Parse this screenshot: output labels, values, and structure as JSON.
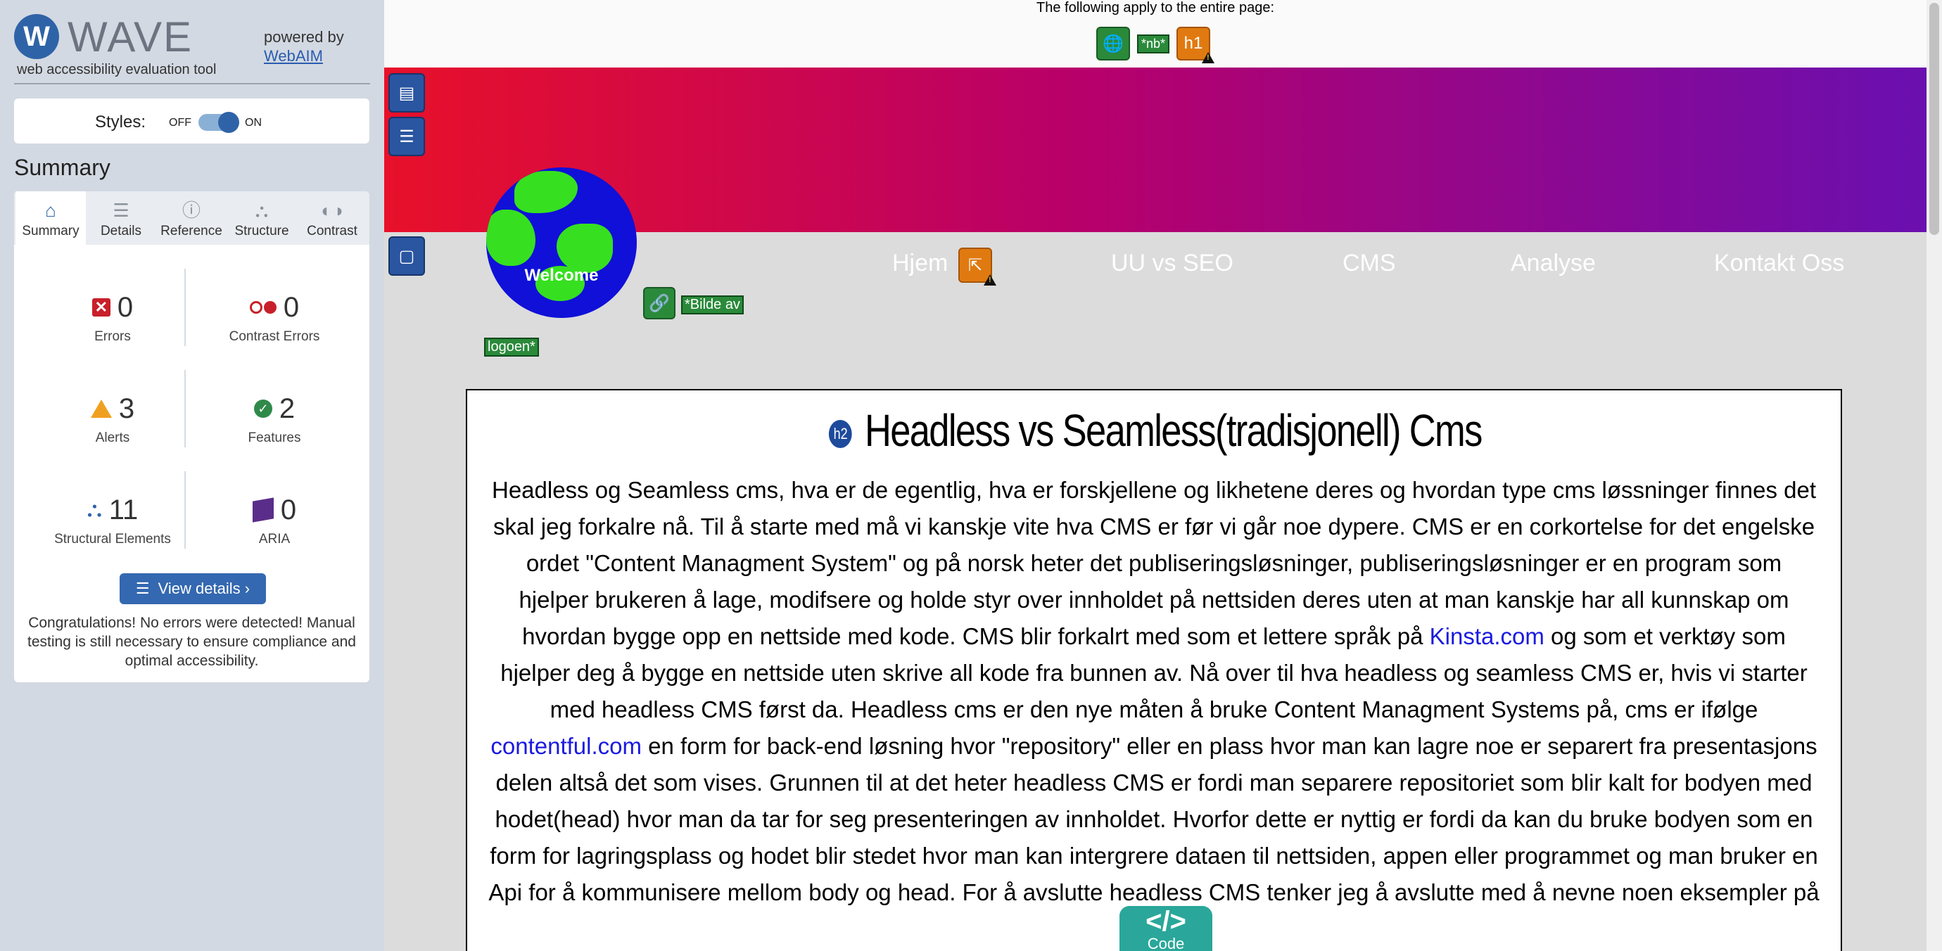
{
  "wave": {
    "logo_mark": "W",
    "logo_text": "WAVE",
    "logo_subtitle": "web accessibility evaluation tool",
    "powered_by": "powered by",
    "powered_link": "WebAIM",
    "styles_label": "Styles:",
    "styles_off": "OFF",
    "styles_on": "ON",
    "styles_state": "on",
    "summary_title": "Summary",
    "tabs": [
      {
        "label": "Summary",
        "icon": "home-icon"
      },
      {
        "label": "Details",
        "icon": "list-icon"
      },
      {
        "label": "Reference",
        "icon": "info-icon"
      },
      {
        "label": "Structure",
        "icon": "structure-icon"
      },
      {
        "label": "Contrast",
        "icon": "contrast-icon"
      }
    ],
    "stats": {
      "errors": {
        "value": "0",
        "label": "Errors"
      },
      "contrast_errors": {
        "value": "0",
        "label": "Contrast Errors"
      },
      "alerts": {
        "value": "3",
        "label": "Alerts"
      },
      "features": {
        "value": "2",
        "label": "Features"
      },
      "structural": {
        "value": "11",
        "label": "Structural Elements"
      },
      "aria": {
        "value": "0",
        "label": "ARIA"
      }
    },
    "view_details": "View details ›",
    "congrats": "Congratulations! No errors were detected! Manual testing is still necessary to ensure compliance and optimal accessibility."
  },
  "preview": {
    "page_notice": "The following apply to the entire page:",
    "lang_tag": "*nb*",
    "h1_tag": "h1",
    "logo_welcome": "Welcome",
    "alt_text_1": "*Bilde av",
    "alt_text_2": "logoen*",
    "nav": [
      "Hjem",
      "UU vs SEO",
      "CMS",
      "Analyse",
      "Kontakt Oss"
    ],
    "h2_tag": "h2",
    "heading": "Headless vs Seamless(tradisjonell) Cms",
    "para_1": "Headless og Seamless cms, hva er de egentlig, hva er forskjellene og likhetene deres og hvordan type cms løssninger finnes det skal jeg forkalre nå. Til å starte med må vi kanskje vite hva CMS er før vi går noe dypere. CMS er en corkortelse for det engelske ordet \"Content Managment System\" og på norsk heter det publiseringsløsninger, publiseringsløsninger er en program som hjelper brukeren å lage, modifsere og holde styr over innholdet på nettsiden deres uten at man kanskje har all kunnskap om hvordan bygge opp en nettside med kode. CMS blir forkalrt med som et lettere språk på ",
    "link_1": "Kinsta.com",
    "para_2": " og som et verktøy som hjelper deg å bygge en nettside uten skrive all kode fra bunnen av. Nå over til hva headless og seamless CMS er, hvis vi starter med headless CMS først da. Headless cms er den nye måten å bruke Content Managment Systems på, cms er ifølge ",
    "link_2": "contentful.com",
    "para_3": " en form for back-end løsning hvor \"repository\" eller en plass hvor man kan lagre noe er separert fra presentasjons delen altså det som vises. Grunnen til at det heter headless CMS er fordi man separere repositoriet som blir kalt for bodyen med hodet(head) hvor man da tar for seg presenteringen av innholdet. Hvorfor dette er nyttig er fordi da kan du bruke bodyen som en form for lagringsplass og hodet blir stedet hvor man kan intergrere dataen til nettsiden, appen eller programmet og man bruker en Api for å kommunisere mellom body og head. For å avslutte headless CMS tenker jeg å avslutte med å nevne noen eksempler på",
    "code_symbol": "</>",
    "code_label": "Code"
  },
  "colors": {
    "wave_blue": "#2f63a7",
    "error_red": "#c8202a",
    "alert_orange": "#f0a020",
    "feature_green": "#2f8a4a",
    "banner_start": "#e8102a",
    "banner_end": "#6a0fb0"
  }
}
